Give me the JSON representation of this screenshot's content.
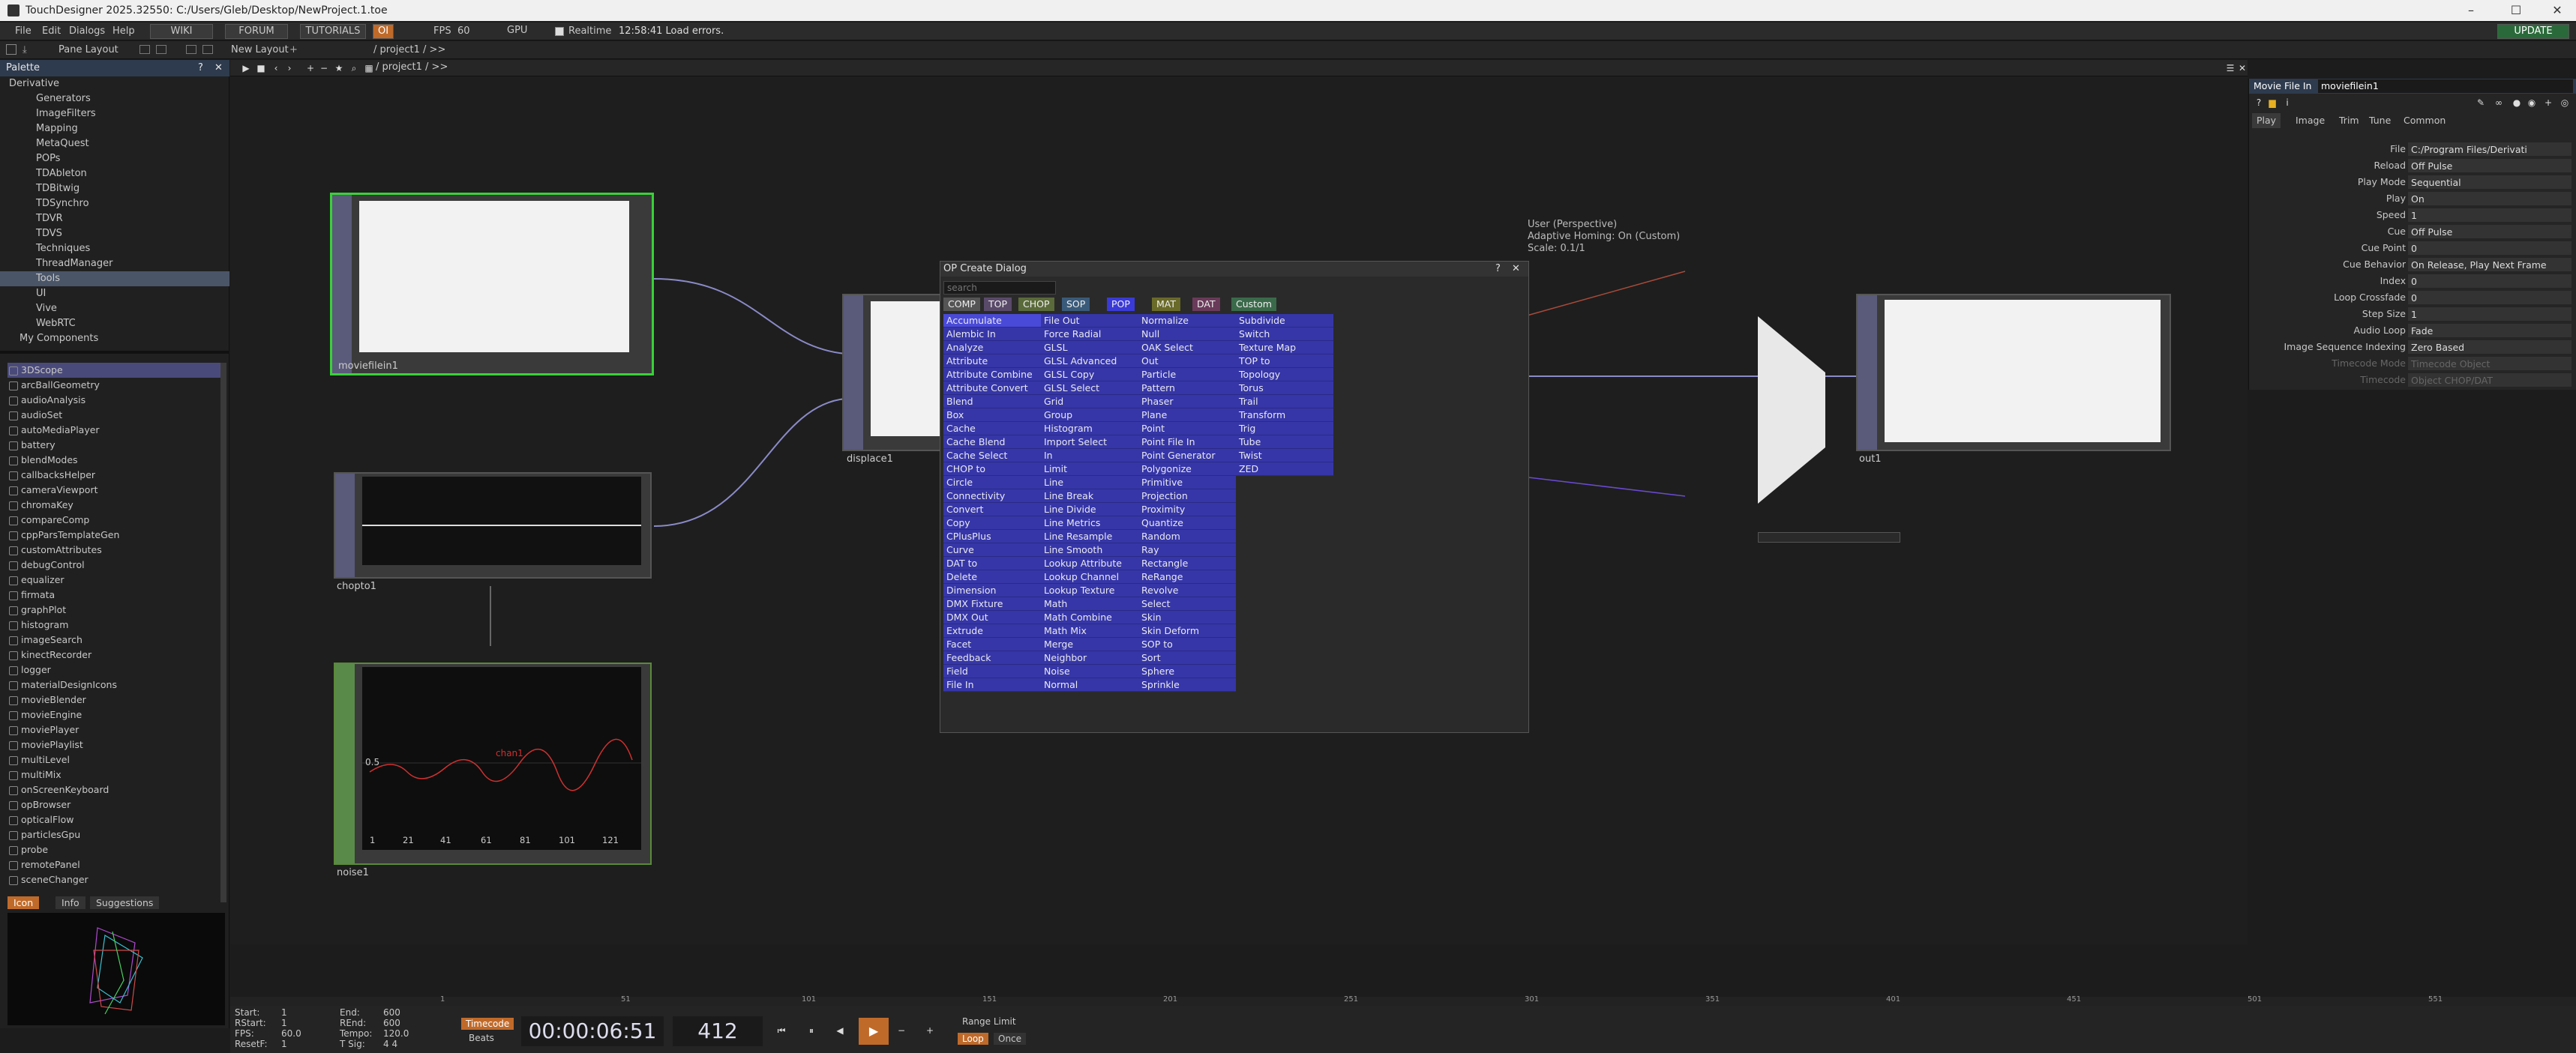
{
  "window": {
    "title": "TouchDesigner 2025.32550: C:/Users/Gleb/Desktop/NewProject.1.toe",
    "min": "–",
    "max": "☐",
    "close": "✕"
  },
  "menu": {
    "items": [
      "File",
      "Edit",
      "Dialogs",
      "Help"
    ],
    "wiki": "WIKI",
    "forum": "FORUM",
    "tutorials": "TUTORIALS",
    "oi": "OI",
    "fps_label": "FPS",
    "fps_val": "60",
    "gpu": "GPU",
    "realtime": "Realtime",
    "status": "12:58:41 Load errors.",
    "update": "UPDATE"
  },
  "toolbar2": {
    "pane_layout": "Pane Layout",
    "new_layout": "New Layout",
    "path": "/ project1 / >>"
  },
  "palette": {
    "title": "Palette",
    "tree": [
      "Derivative",
      "Generators",
      "ImageFilters",
      "Mapping",
      "MetaQuest",
      "POPs",
      "TDAbleton",
      "TDBitwig",
      "TDSynchro",
      "TDVR",
      "TDVS",
      "Techniques",
      "ThreadManager",
      "Tools",
      "UI",
      "Vive",
      "WebRTC",
      "My Components"
    ],
    "components": [
      "3DScope",
      "arcBallGeometry",
      "audioAnalysis",
      "audioSet",
      "autoMediaPlayer",
      "battery",
      "blendModes",
      "callbacksHelper",
      "cameraViewport",
      "chromaKey",
      "compareComp",
      "cppParsTemplateGen",
      "customAttributes",
      "debugControl",
      "equalizer",
      "firmata",
      "graphPlot",
      "histogram",
      "imageSearch",
      "kinectRecorder",
      "logger",
      "materialDesignIcons",
      "movieBlender",
      "movieEngine",
      "moviePlayer",
      "moviePlaylist",
      "multiLevel",
      "multiMix",
      "onScreenKeyboard",
      "opBrowser",
      "opticalFlow",
      "particlesGpu",
      "probe",
      "remotePanel",
      "sceneChanger"
    ],
    "tabs": [
      "Icon",
      "Info",
      "Suggestions"
    ]
  },
  "nodes": {
    "moviefilein1": "moviefilein1",
    "displace1": "displace1",
    "chopto1": "chopto1",
    "noise1": "noise1",
    "out1": "out1",
    "noise_chan": "chan1",
    "noise_y1": "0.5",
    "noise_ticks": [
      "1",
      "21",
      "41",
      "61",
      "81",
      "101",
      "121"
    ]
  },
  "viewer": {
    "line1": "User (Perspective)",
    "line2": "Adaptive Homing: On (Custom)",
    "line3": "Scale: 0.1/1"
  },
  "dialog": {
    "title": "OP Create Dialog",
    "help": "?",
    "close": "✕",
    "search": "search",
    "tabs": [
      "COMP",
      "TOP",
      "CHOP",
      "SOP",
      "POP",
      "MAT",
      "DAT",
      "Custom"
    ],
    "tab_colors": [
      "#555",
      "#5a4a6a",
      "#5a6a3a",
      "#3a5a7a",
      "#3a3ad8",
      "#6a6a2a",
      "#6a3a5a",
      "#3a6a4a"
    ],
    "col1": [
      "Accumulate",
      "Alembic In",
      "Analyze",
      "Attribute",
      "Attribute Combine",
      "Attribute Convert",
      "Blend",
      "Box",
      "Cache",
      "Cache Blend",
      "Cache Select",
      "CHOP to",
      "Circle",
      "Connectivity",
      "Convert",
      "Copy",
      "CPlusPlus",
      "Curve",
      "DAT to",
      "Delete",
      "Dimension",
      "DMX Fixture",
      "DMX Out",
      "Extrude",
      "Facet",
      "Feedback",
      "Field",
      "File In"
    ],
    "col2": [
      "File Out",
      "Force Radial",
      "GLSL",
      "GLSL Advanced",
      "GLSL Copy",
      "GLSL Select",
      "Grid",
      "Group",
      "Histogram",
      "Import Select",
      "In",
      "Limit",
      "Line",
      "Line Break",
      "Line Divide",
      "Line Metrics",
      "Line Resample",
      "Line Smooth",
      "Lookup Attribute",
      "Lookup Channel",
      "Lookup Texture",
      "Math",
      "Math Combine",
      "Math Mix",
      "Merge",
      "Neighbor",
      "Noise",
      "Normal"
    ],
    "col3": [
      "Normalize",
      "Null",
      "OAK Select",
      "Out",
      "Particle",
      "Pattern",
      "Phaser",
      "Plane",
      "Point",
      "Point File In",
      "Point Generator",
      "Polygonize",
      "Primitive",
      "Projection",
      "Proximity",
      "Quantize",
      "Random",
      "Ray",
      "Rectangle",
      "ReRange",
      "Revolve",
      "Select",
      "Skin",
      "Skin Deform",
      "SOP to",
      "Sort",
      "Sphere",
      "Sprinkle"
    ],
    "col4": [
      "Subdivide",
      "Switch",
      "Texture Map",
      "TOP to",
      "Topology",
      "Torus",
      "Trail",
      "Transform",
      "Trig",
      "Tube",
      "Twist",
      "ZED"
    ]
  },
  "params": {
    "type": "Movie File In",
    "name": "moviefilein1",
    "tabs": [
      "Play",
      "Image",
      "Trim",
      "Tune",
      "Common"
    ],
    "rows": [
      {
        "name": "File",
        "value": "C:/Program Files/Derivati"
      },
      {
        "name": "Reload",
        "value": "Off   Pulse"
      },
      {
        "name": "Play Mode",
        "value": "Sequential"
      },
      {
        "name": "Play",
        "value": "On"
      },
      {
        "name": "Speed",
        "value": "1"
      },
      {
        "name": "Cue",
        "value": "Off   Pulse"
      },
      {
        "name": "Cue Point",
        "value": "0"
      },
      {
        "name": "Cue Behavior",
        "value": "On Release, Play Next Frame"
      },
      {
        "name": "Index",
        "value": "0"
      },
      {
        "name": "Loop Crossfade",
        "value": "0"
      },
      {
        "name": "Step Size",
        "value": "1"
      },
      {
        "name": "Audio Loop",
        "value": "Fade"
      },
      {
        "name": "Image Sequence Indexing",
        "value": "Zero Based"
      },
      {
        "name": "Timecode Mode",
        "value": "Timecode Object"
      },
      {
        "name": "Timecode",
        "value": "Object CHOP/DAT"
      }
    ]
  },
  "timeline": {
    "ticks": [
      "1",
      "51",
      "101",
      "151",
      "201",
      "251",
      "301",
      "351",
      "401",
      "451",
      "501",
      "551"
    ]
  },
  "bottom": {
    "start_l": "Start:",
    "start_v": "1",
    "end_l": "End:",
    "end_v": "600",
    "rstart_l": "RStart:",
    "rstart_v": "1",
    "rend_l": "REnd:",
    "rend_v": "600",
    "fps_l": "FPS:",
    "fps_v": "60.0",
    "tempo_l": "Tempo:",
    "tempo_v": "120.0",
    "reset_l": "ResetF:",
    "reset_v": "1",
    "tsig_l": "T Sig:",
    "tsig_v": "4   4",
    "timecode": "Timecode",
    "beats": "Beats",
    "time": "00:00:06:51",
    "frame": "412",
    "range": "Range Limit",
    "loop": "Loop",
    "once": "Once"
  }
}
